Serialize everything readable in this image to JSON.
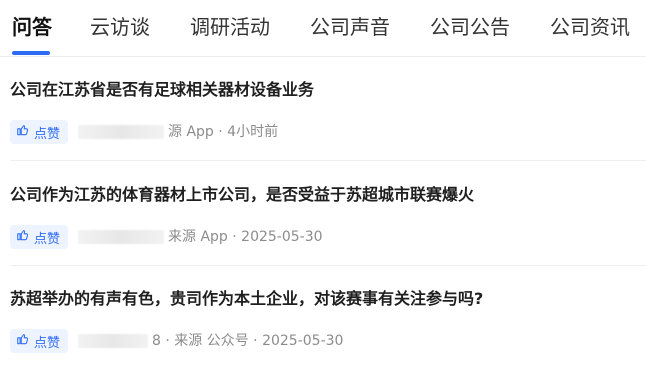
{
  "tabs": [
    {
      "label": "问答"
    },
    {
      "label": "云访谈"
    },
    {
      "label": "调研活动"
    },
    {
      "label": "公司声音"
    },
    {
      "label": "公司公告"
    },
    {
      "label": "公司资讯"
    }
  ],
  "items": [
    {
      "title": "公司在江苏省是否有足球相关器材设备业务",
      "like_label": "点赞",
      "meta": "源 App · 4小时前"
    },
    {
      "title": "公司作为江苏的体育器材上市公司，是否受益于苏超城市联赛爆火",
      "like_label": "点赞",
      "meta": "来源 App · 2025-05-30"
    },
    {
      "title": "苏超举办的有声有色，贵司作为本土企业，对该赛事有关注参与吗?",
      "like_label": "点赞",
      "meta": "8 · 来源 公众号 · 2025-05-30"
    }
  ],
  "colors": {
    "accent": "#2f6cf6",
    "like_bg": "#edf3ff",
    "meta_text": "#8c8c8c"
  },
  "icons": {
    "like": "thumbs-up-icon"
  }
}
